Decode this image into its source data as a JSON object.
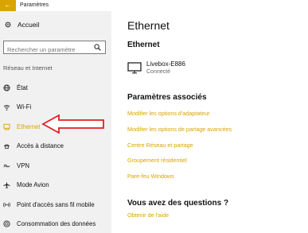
{
  "window": {
    "title": "Paramètres",
    "back_glyph": "←"
  },
  "sidebar": {
    "home_label": "Accueil",
    "search": {
      "placeholder": "Rechercher un paramètre",
      "value": ""
    },
    "section_label": "Réseau et Internet",
    "items": [
      {
        "label": "État",
        "icon": "globe-icon"
      },
      {
        "label": "Wi-Fi",
        "icon": "wifi-icon"
      },
      {
        "label": "Ethernet",
        "icon": "ethernet-icon",
        "active": true
      },
      {
        "label": "Accès à distance",
        "icon": "dialup-icon"
      },
      {
        "label": "VPN",
        "icon": "vpn-icon"
      },
      {
        "label": "Mode Avion",
        "icon": "airplane-icon"
      },
      {
        "label": "Point d'accès sans fil mobile",
        "icon": "hotspot-icon"
      },
      {
        "label": "Consommation des données",
        "icon": "data-usage-icon"
      }
    ]
  },
  "main": {
    "page_title": "Ethernet",
    "ethernet_heading": "Ethernet",
    "network": {
      "name": "Livebox-E886",
      "status": "Connecté"
    },
    "related_heading": "Paramètres associés",
    "related_links": [
      "Modifier les options d'adaptateur",
      "Modifier les options de partage avancées",
      "Centre Réseau et partage",
      "Groupement résidentiel",
      "Pare-feu Windows"
    ],
    "questions_heading": "Vous avez des questions ?",
    "help_link": "Obtenir de l'aide"
  },
  "colors": {
    "accent": "#d9a400",
    "arrow": "#e02020",
    "sidebar_bg": "#f1f1f1"
  }
}
